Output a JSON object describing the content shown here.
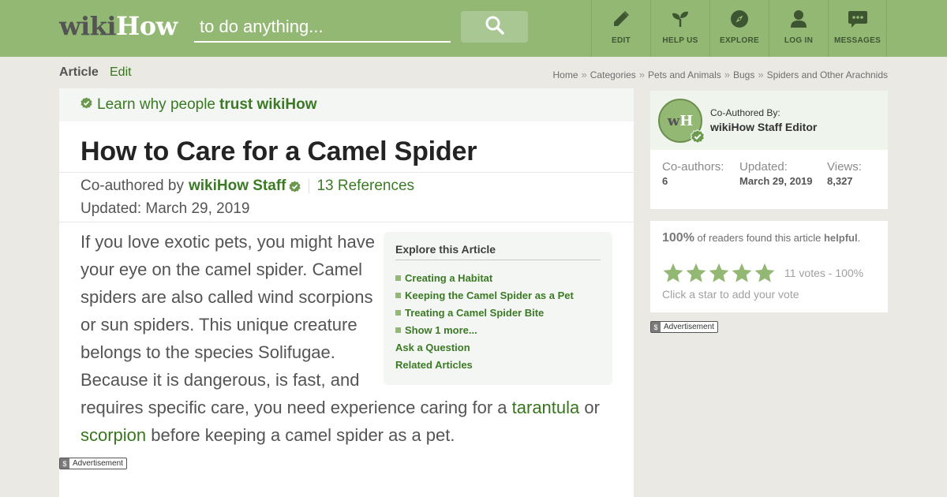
{
  "header": {
    "logo": {
      "part1": "wiki",
      "part2": "How"
    },
    "search": {
      "placeholder": "to do anything...",
      "value": "",
      "button_icon": "search-icon"
    },
    "nav": [
      {
        "label": "EDIT",
        "icon": "pencil-icon"
      },
      {
        "label": "HELP US",
        "icon": "sprout-icon"
      },
      {
        "label": "EXPLORE",
        "icon": "compass-icon"
      },
      {
        "label": "LOG IN",
        "icon": "user-icon"
      },
      {
        "label": "MESSAGES",
        "icon": "chat-icon"
      }
    ]
  },
  "tabs": {
    "article": "Article",
    "edit": "Edit"
  },
  "breadcrumbs": [
    "Home",
    "Categories",
    "Pets and Animals",
    "Bugs",
    "Spiders and Other Arachnids"
  ],
  "breadcrumb_separator": "»",
  "article": {
    "trust_prefix": "Learn why people",
    "trust_link": "trust wikiHow",
    "title": "How to Care for a Camel Spider",
    "byline_prefix": "Co-authored by",
    "author": "wikiHow Staff",
    "references": "13 References",
    "updated": "Updated: March 29, 2019",
    "intro": {
      "text1": "If you love exotic pets, you might have your eye on the camel spider. Camel spiders are also called wind scorpions or sun spiders. This unique creature belongs to the species Solifugae. Because it is dangerous, is fast, and requires specific care, you need experience caring for a ",
      "link1": "tarantula",
      "text2": " or ",
      "link2": "scorpion",
      "text3": " before keeping a camel spider as a pet."
    },
    "toc": {
      "heading": "Explore this Article",
      "items": [
        "Creating a Habitat",
        "Keeping the Camel Spider as a Pet",
        "Treating a Camel Spider Bite",
        "Show 1 more..."
      ],
      "extra": [
        "Ask a Question",
        "Related Articles"
      ]
    },
    "ad_label": "Advertisement",
    "ad_symbol": "$"
  },
  "sidebar": {
    "coauthor": {
      "avatar_text1": "w",
      "avatar_text2": "H",
      "label": "Co-Authored By:",
      "name": "wikiHow Staff Editor"
    },
    "stats": [
      {
        "label": "Co-authors:",
        "value": "6"
      },
      {
        "label": "Updated:",
        "value": "March 29, 2019"
      },
      {
        "label": "Views:",
        "value": "8,327"
      }
    ],
    "rating": {
      "percent": "100%",
      "text": "of readers found this article",
      "word": "helpful",
      "votes": "11 votes - 100%",
      "prompt": "Click a star to add your vote",
      "stars_filled": 5,
      "stars_total": 5
    },
    "ad_label": "Advertisement",
    "ad_symbol": "$"
  },
  "colors": {
    "brand_green": "#93b874",
    "link_green": "#38761d",
    "text": "#545454",
    "background": "#ebe9e4"
  }
}
